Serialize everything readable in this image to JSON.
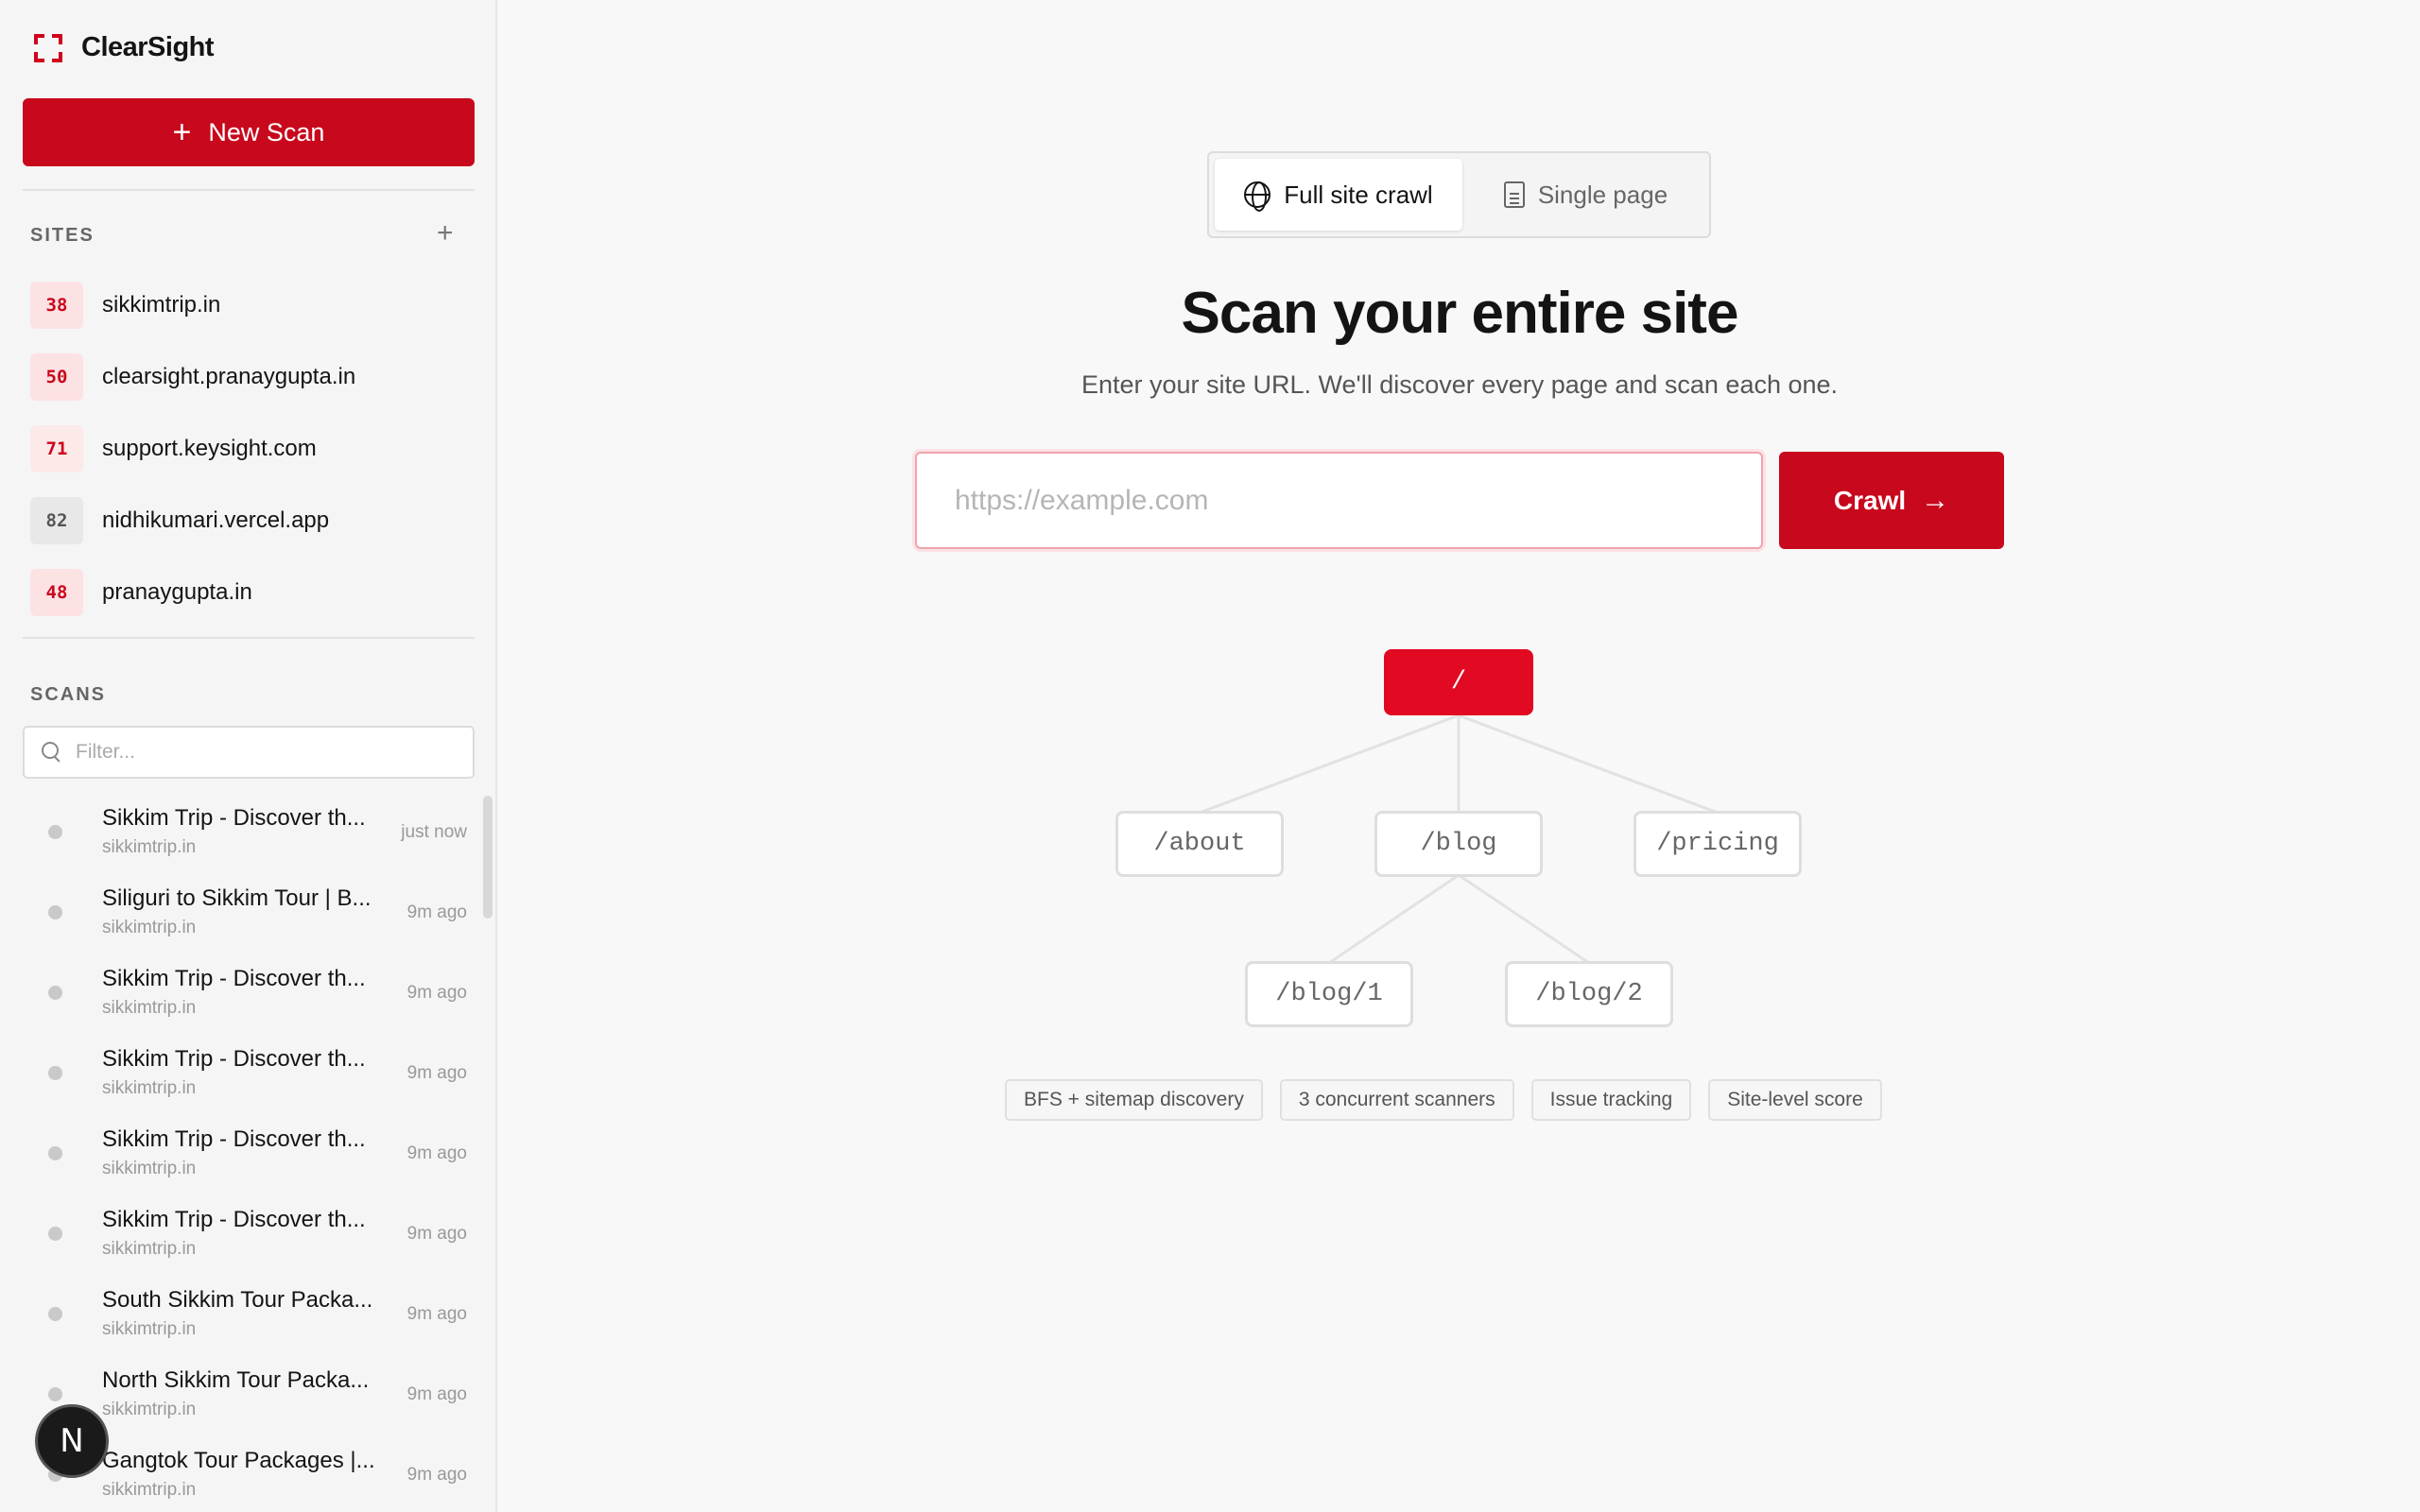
{
  "app": {
    "name": "ClearSight",
    "accent": "#c8081c"
  },
  "sidebar": {
    "new_scan_label": "New Scan",
    "sites_label": "SITES",
    "add_site_symbol": "+",
    "sites": [
      {
        "score": "38",
        "name": "sikkimtrip.in",
        "badge_bg": "#fde2e4",
        "badge_fg": "#c8081c"
      },
      {
        "score": "50",
        "name": "clearsight.pranaygupta.in",
        "badge_bg": "#fde2e4",
        "badge_fg": "#c8081c"
      },
      {
        "score": "71",
        "name": "support.keysight.com",
        "badge_bg": "#fbeae8",
        "badge_fg": "#d0021b"
      },
      {
        "score": "82",
        "name": "nidhikumari.vercel.app",
        "badge_bg": "#e8e8e8",
        "badge_fg": "#555555"
      },
      {
        "score": "48",
        "name": "pranaygupta.in",
        "badge_bg": "#fde2e4",
        "badge_fg": "#c8081c"
      }
    ],
    "scans_label": "SCANS",
    "filter_placeholder": "Filter...",
    "scans": [
      {
        "title": "Sikkim Trip - Discover th...",
        "domain": "sikkimtrip.in",
        "time": "just now"
      },
      {
        "title": "Siliguri to Sikkim Tour | B...",
        "domain": "sikkimtrip.in",
        "time": "9m ago"
      },
      {
        "title": "Sikkim Trip - Discover th...",
        "domain": "sikkimtrip.in",
        "time": "9m ago"
      },
      {
        "title": "Sikkim Trip - Discover th...",
        "domain": "sikkimtrip.in",
        "time": "9m ago"
      },
      {
        "title": "Sikkim Trip - Discover th...",
        "domain": "sikkimtrip.in",
        "time": "9m ago"
      },
      {
        "title": "Sikkim Trip - Discover th...",
        "domain": "sikkimtrip.in",
        "time": "9m ago"
      },
      {
        "title": "South Sikkim Tour Packa...",
        "domain": "sikkimtrip.in",
        "time": "9m ago"
      },
      {
        "title": "North Sikkim Tour Packa...",
        "domain": "sikkimtrip.in",
        "time": "9m ago"
      },
      {
        "title": "Gangtok Tour Packages |...",
        "domain": "sikkimtrip.in",
        "time": "9m ago"
      }
    ],
    "avatar_letter": "N"
  },
  "main": {
    "modes": {
      "full": "Full site crawl",
      "single": "Single page"
    },
    "title": "Scan your entire site",
    "subtitle": "Enter your site URL. We'll discover every page and scan each one.",
    "url_placeholder": "https://example.com",
    "crawl_label": "Crawl",
    "tree": {
      "root": "/",
      "about": "/about",
      "blog": "/blog",
      "pricing": "/pricing",
      "blog1": "/blog/1",
      "blog2": "/blog/2"
    },
    "chips": [
      "BFS + sitemap discovery",
      "3 concurrent scanners",
      "Issue tracking",
      "Site-level score"
    ]
  }
}
